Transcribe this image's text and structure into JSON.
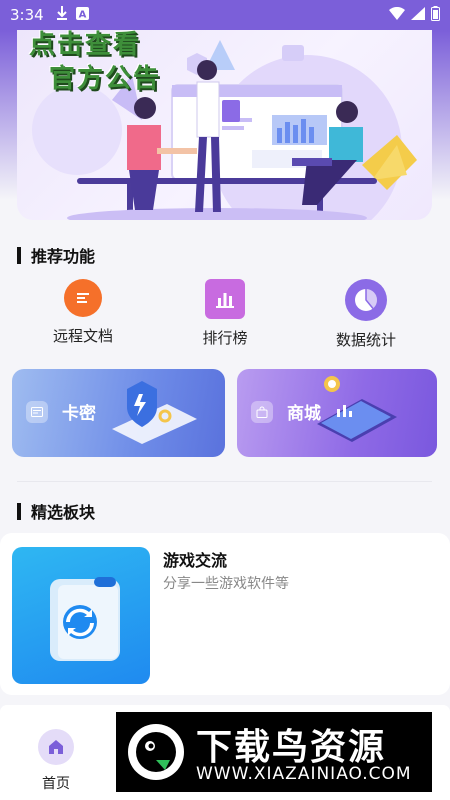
{
  "status_bar": {
    "time": "3:34",
    "icons": [
      "download-icon",
      "a-icon",
      "wifi-icon",
      "signal-icon",
      "battery-icon"
    ]
  },
  "banner": {
    "line1": "点击查看",
    "line2": "官方公告"
  },
  "recommended": {
    "title": "推荐功能",
    "items": [
      {
        "label": "远程文档",
        "icon": "document-icon",
        "color": "#f5702a"
      },
      {
        "label": "排行榜",
        "icon": "bar-chart-icon",
        "color": "#c86be0"
      },
      {
        "label": "数据统计",
        "icon": "pie-chart-icon",
        "color": "#8b6be6"
      }
    ]
  },
  "promos": [
    {
      "label": "卡密",
      "icon": "card-icon"
    },
    {
      "label": "商城",
      "icon": "bag-icon"
    }
  ],
  "featured": {
    "title": "精选板块",
    "board": {
      "title": "游戏交流",
      "desc": "分享一些游戏软件等"
    }
  },
  "tab_bar": {
    "home_label": "首页"
  },
  "watermark": {
    "brand": "下载鸟资源",
    "url": "WWW.XIAZAINIAO.COM"
  },
  "colors": {
    "accent": "#7b5fd9",
    "orange": "#f5702a",
    "purple_pink": "#c86be0",
    "violet": "#8b6be6"
  }
}
